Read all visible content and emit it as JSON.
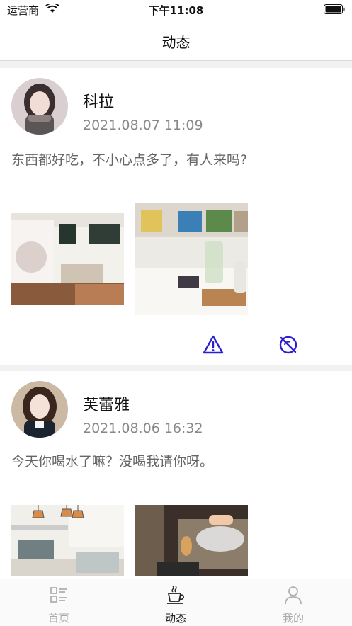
{
  "status_bar": {
    "carrier": "运营商",
    "time": "下午11:08"
  },
  "nav": {
    "title": "动态"
  },
  "posts": [
    {
      "name": "科拉",
      "date": "2021.08.07  11:09",
      "content": "东西都好吃，不小心点多了，有人来吗?"
    },
    {
      "name": "芙蕾雅",
      "date": "2021.08.06  16:32",
      "content": "今天你喝水了嘛？没喝我请你呀。"
    }
  ],
  "tabs": [
    {
      "label": "首页",
      "icon": "home-list-icon"
    },
    {
      "label": "动态",
      "icon": "coffee-cup-icon",
      "active": true
    },
    {
      "label": "我的",
      "icon": "user-icon"
    }
  ],
  "colors": {
    "accent": "#2b1fcf",
    "tab_inactive": "#aaaaaa",
    "divider": "#f1f1f1"
  }
}
